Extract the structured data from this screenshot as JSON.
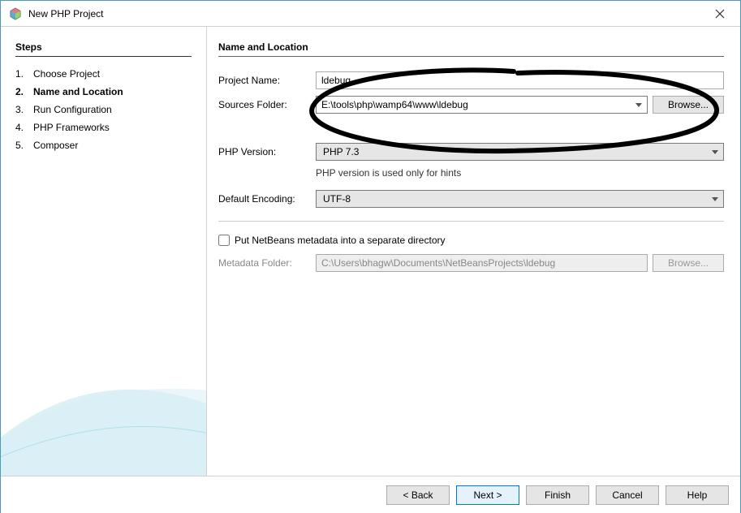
{
  "window": {
    "title": "New PHP Project"
  },
  "steps": {
    "heading": "Steps",
    "items": [
      {
        "num": "1.",
        "label": "Choose Project",
        "active": false
      },
      {
        "num": "2.",
        "label": "Name and Location",
        "active": true
      },
      {
        "num": "3.",
        "label": "Run Configuration",
        "active": false
      },
      {
        "num": "4.",
        "label": "PHP Frameworks",
        "active": false
      },
      {
        "num": "5.",
        "label": "Composer",
        "active": false
      }
    ]
  },
  "content": {
    "section_title": "Name and Location",
    "project_name_label": "Project Name:",
    "project_name_value": "ldebug",
    "sources_folder_label": "Sources Folder:",
    "sources_folder_value": "E:\\tools\\php\\wamp64\\www\\ldebug",
    "browse_label": "Browse...",
    "php_version_label": "PHP Version:",
    "php_version_value": "PHP 7.3",
    "php_version_hint": "PHP version is used only for hints",
    "default_encoding_label": "Default Encoding:",
    "default_encoding_value": "UTF-8",
    "metadata_checkbox_label": "Put NetBeans metadata into a separate directory",
    "metadata_folder_label": "Metadata Folder:",
    "metadata_folder_value": "C:\\Users\\bhagw\\Documents\\NetBeansProjects\\ldebug",
    "metadata_browse_label": "Browse..."
  },
  "footer": {
    "back": "< Back",
    "next": "Next >",
    "finish": "Finish",
    "cancel": "Cancel",
    "help": "Help"
  }
}
